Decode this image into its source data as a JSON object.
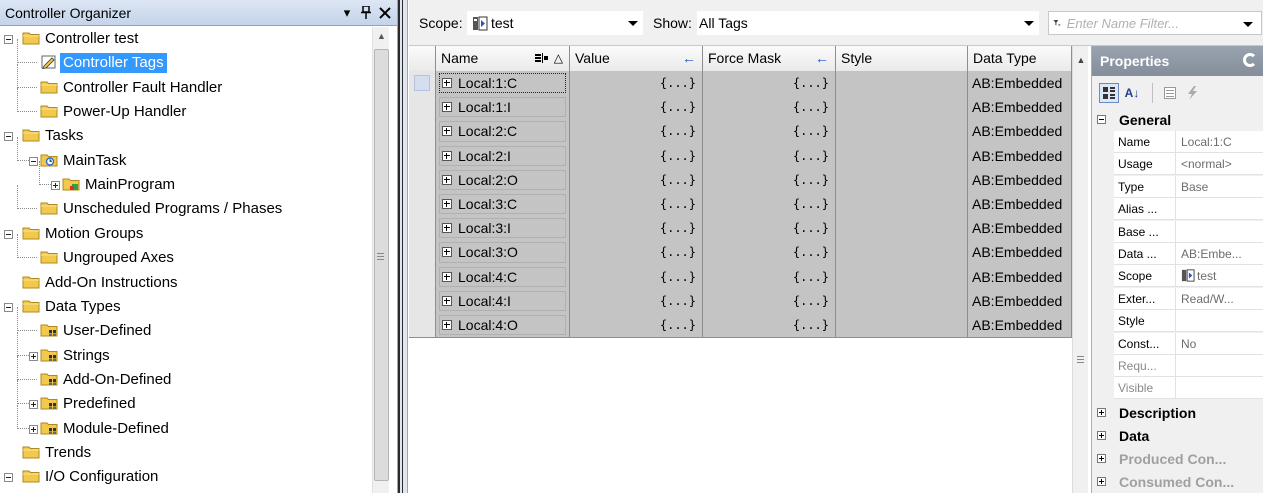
{
  "organizer": {
    "title": "Controller Organizer",
    "pin_glyph": "ⴃ",
    "close_glyph": "✕",
    "menu_glyph": "▾",
    "tree": [
      {
        "label": "Controller test",
        "level": 0,
        "expander": "minus",
        "icon": "folder"
      },
      {
        "label": "Controller Tags",
        "level": 1,
        "expander": "none",
        "icon": "tags",
        "selected": true
      },
      {
        "label": "Controller Fault Handler",
        "level": 1,
        "expander": "none",
        "icon": "folder"
      },
      {
        "label": "Power-Up Handler",
        "level": 1,
        "expander": "none",
        "icon": "folder"
      },
      {
        "label": "Tasks",
        "level": 0,
        "expander": "minus",
        "icon": "folder"
      },
      {
        "label": "MainTask",
        "level": 1,
        "expander": "minus",
        "icon": "task"
      },
      {
        "label": "MainProgram",
        "level": 2,
        "expander": "plus",
        "icon": "program"
      },
      {
        "label": "Unscheduled Programs / Phases",
        "level": 1,
        "expander": "none",
        "icon": "folder"
      },
      {
        "label": "Motion Groups",
        "level": 0,
        "expander": "minus",
        "icon": "folder"
      },
      {
        "label": "Ungrouped Axes",
        "level": 1,
        "expander": "none",
        "icon": "folder"
      },
      {
        "label": "Add-On Instructions",
        "level": 0,
        "expander": "none",
        "icon": "folder"
      },
      {
        "label": "Data Types",
        "level": 0,
        "expander": "minus",
        "icon": "folder"
      },
      {
        "label": "User-Defined",
        "level": 1,
        "expander": "none",
        "icon": "datatype"
      },
      {
        "label": "Strings",
        "level": 1,
        "expander": "plus",
        "icon": "datatype"
      },
      {
        "label": "Add-On-Defined",
        "level": 1,
        "expander": "none",
        "icon": "datatype"
      },
      {
        "label": "Predefined",
        "level": 1,
        "expander": "plus",
        "icon": "datatype"
      },
      {
        "label": "Module-Defined",
        "level": 1,
        "expander": "plus",
        "icon": "datatype"
      },
      {
        "label": "Trends",
        "level": 0,
        "expander": "none",
        "icon": "folder"
      },
      {
        "label": "I/O Configuration",
        "level": 0,
        "expander": "minus",
        "icon": "folder"
      }
    ]
  },
  "toolbar": {
    "scope_label": "Scope:",
    "scope_value": "test",
    "show_label": "Show:",
    "show_value": "All Tags",
    "filter_placeholder": "Enter Name Filter..."
  },
  "grid": {
    "columns": [
      "Name",
      "Value",
      "Force Mask",
      "Style",
      "Data Type"
    ],
    "name_sort_glyph": "△",
    "value_arrow": "←",
    "force_arrow": "←",
    "rows": [
      {
        "name": "Local:1:C",
        "value": "{...}",
        "force_mask": "{...}",
        "style": "",
        "data_type": "AB:Embedded"
      },
      {
        "name": "Local:1:I",
        "value": "{...}",
        "force_mask": "{...}",
        "style": "",
        "data_type": "AB:Embedded"
      },
      {
        "name": "Local:2:C",
        "value": "{...}",
        "force_mask": "{...}",
        "style": "",
        "data_type": "AB:Embedded"
      },
      {
        "name": "Local:2:I",
        "value": "{...}",
        "force_mask": "{...}",
        "style": "",
        "data_type": "AB:Embedded"
      },
      {
        "name": "Local:2:O",
        "value": "{...}",
        "force_mask": "{...}",
        "style": "",
        "data_type": "AB:Embedded"
      },
      {
        "name": "Local:3:C",
        "value": "{...}",
        "force_mask": "{...}",
        "style": "",
        "data_type": "AB:Embedded"
      },
      {
        "name": "Local:3:I",
        "value": "{...}",
        "force_mask": "{...}",
        "style": "",
        "data_type": "AB:Embedded"
      },
      {
        "name": "Local:3:O",
        "value": "{...}",
        "force_mask": "{...}",
        "style": "",
        "data_type": "AB:Embedded"
      },
      {
        "name": "Local:4:C",
        "value": "{...}",
        "force_mask": "{...}",
        "style": "",
        "data_type": "AB:Embedded"
      },
      {
        "name": "Local:4:I",
        "value": "{...}",
        "force_mask": "{...}",
        "style": "",
        "data_type": "AB:Embedded"
      },
      {
        "name": "Local:4:O",
        "value": "{...}",
        "force_mask": "{...}",
        "style": "",
        "data_type": "AB:Embedded"
      }
    ]
  },
  "properties": {
    "title": "Properties",
    "sort_alpha_glyph": "A↓",
    "sections": {
      "general": "General",
      "description": "Description",
      "data": "Data",
      "produced": "Produced Con...",
      "consumed": "Consumed Con..."
    },
    "rows": [
      {
        "name": "Name",
        "value": "Local:1:C"
      },
      {
        "name": "Usage",
        "value": "<normal>"
      },
      {
        "name": "Type",
        "value": "Base"
      },
      {
        "name": "Alias ...",
        "value": ""
      },
      {
        "name": "Base ...",
        "value": ""
      },
      {
        "name": "Data ...",
        "value": "AB:Embe..."
      },
      {
        "name": "Scope",
        "value": "test"
      },
      {
        "name": "Exter...",
        "value": "Read/W..."
      },
      {
        "name": "Style",
        "value": ""
      },
      {
        "name": "Const...",
        "value": "No"
      },
      {
        "name": "Requ...",
        "value": ""
      },
      {
        "name": "Visible",
        "value": ""
      }
    ]
  },
  "colors": {
    "selection": "#3399ff",
    "grid_cell": "#c4c4c4",
    "props_header": "#8b94a1",
    "folder": "#f2c94c",
    "sort_arrow": "#1b4fd8"
  }
}
